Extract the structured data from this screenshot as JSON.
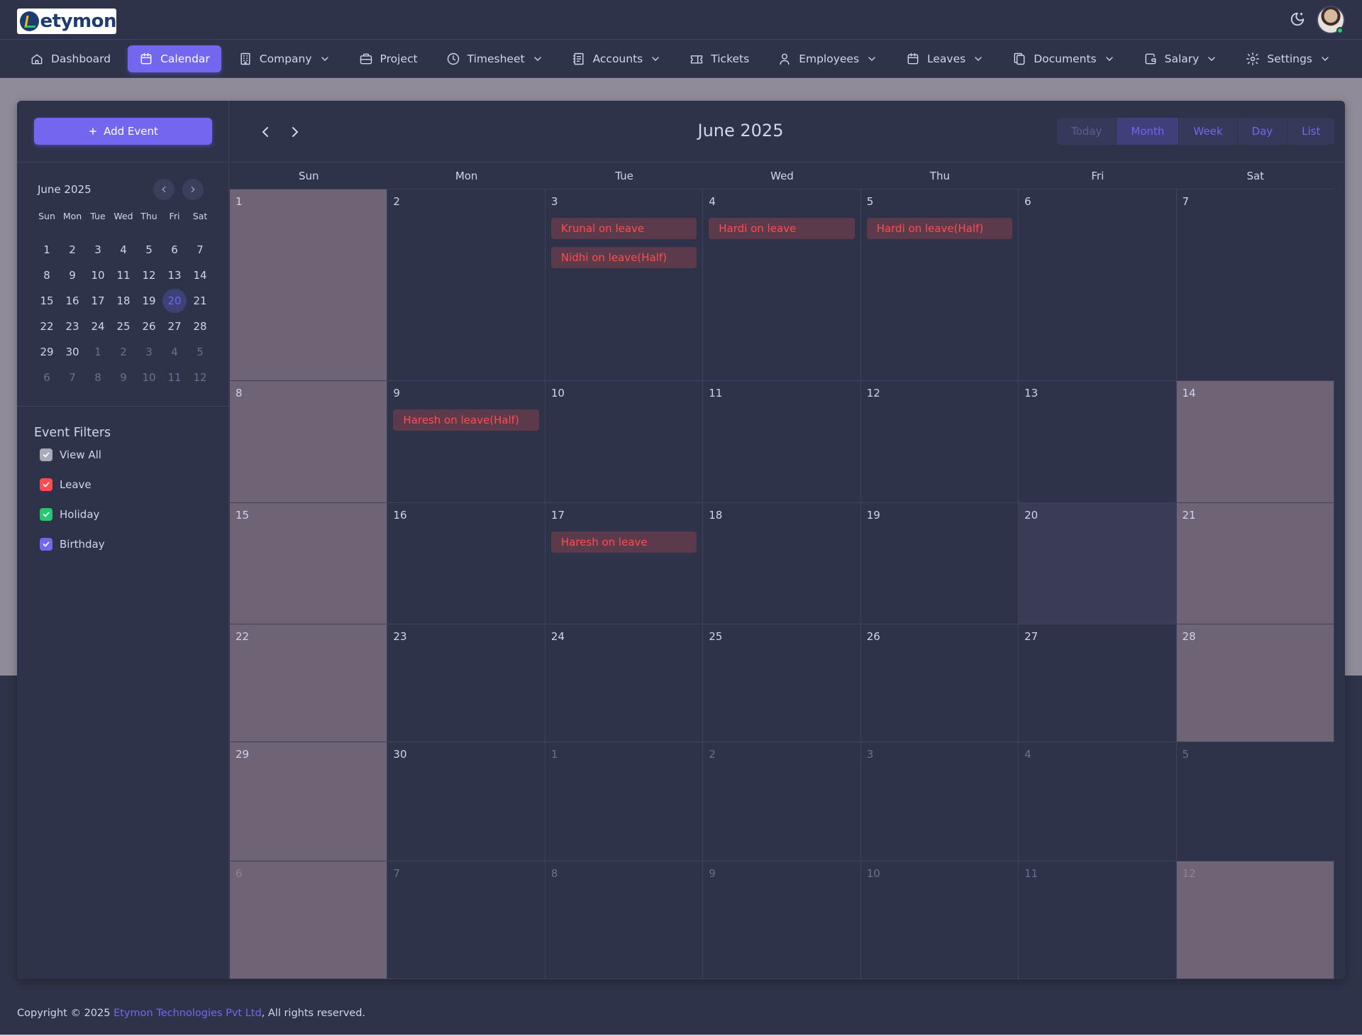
{
  "app": {
    "logo_text": "etymon"
  },
  "nav": {
    "items": [
      {
        "label": "Dashboard",
        "icon": "home-icon",
        "dropdown": false,
        "active": false
      },
      {
        "label": "Calendar",
        "icon": "calendar-icon",
        "dropdown": false,
        "active": true
      },
      {
        "label": "Company",
        "icon": "building-icon",
        "dropdown": true,
        "active": false
      },
      {
        "label": "Project",
        "icon": "briefcase-icon",
        "dropdown": false,
        "active": false
      },
      {
        "label": "Timesheet",
        "icon": "clock-icon",
        "dropdown": true,
        "active": false
      },
      {
        "label": "Accounts",
        "icon": "receipt-icon",
        "dropdown": true,
        "active": false
      },
      {
        "label": "Tickets",
        "icon": "ticket-icon",
        "dropdown": false,
        "active": false
      },
      {
        "label": "Employees",
        "icon": "user-icon",
        "dropdown": true,
        "active": false
      },
      {
        "label": "Leaves",
        "icon": "calendar-icon",
        "dropdown": true,
        "active": false
      },
      {
        "label": "Documents",
        "icon": "files-icon",
        "dropdown": true,
        "active": false
      },
      {
        "label": "Salary",
        "icon": "wallet-icon",
        "dropdown": true,
        "active": false
      },
      {
        "label": "Settings",
        "icon": "gear-icon",
        "dropdown": true,
        "active": false
      }
    ]
  },
  "sidebar": {
    "add_event_label": "Add Event",
    "mini_calendar": {
      "title": "June 2025",
      "weekdays": [
        "Sun",
        "Mon",
        "Tue",
        "Wed",
        "Thu",
        "Fri",
        "Sat"
      ],
      "weeks": [
        [
          "1",
          "2",
          "3",
          "4",
          "5",
          "6",
          "7"
        ],
        [
          "8",
          "9",
          "10",
          "11",
          "12",
          "13",
          "14"
        ],
        [
          "15",
          "16",
          "17",
          "18",
          "19",
          "20",
          "21"
        ],
        [
          "22",
          "23",
          "24",
          "25",
          "26",
          "27",
          "28"
        ],
        [
          "29",
          "30",
          "1",
          "2",
          "3",
          "4",
          "5"
        ],
        [
          "6",
          "7",
          "8",
          "9",
          "10",
          "11",
          "12"
        ]
      ],
      "today": "20"
    },
    "filters_title": "Event Filters",
    "filters": [
      {
        "label": "View All",
        "color": "#a8aab7",
        "checked": true
      },
      {
        "label": "Leave",
        "color": "#ff4c51",
        "checked": true
      },
      {
        "label": "Holiday",
        "color": "#28c76f",
        "checked": true
      },
      {
        "label": "Birthday",
        "color": "#7367f0",
        "checked": true
      }
    ]
  },
  "calendar": {
    "title": "June 2025",
    "views": [
      "Today",
      "Month",
      "Week",
      "Day",
      "List"
    ],
    "active_view": "Month",
    "weekdays": [
      "Sun",
      "Mon",
      "Tue",
      "Wed",
      "Thu",
      "Fri",
      "Sat"
    ],
    "weeks": [
      {
        "days": [
          {
            "n": "1"
          },
          {
            "n": "2"
          },
          {
            "n": "3",
            "events": [
              "Krunal on leave",
              "Nidhi on leave(Half)"
            ]
          },
          {
            "n": "4",
            "events": [
              "Hardi on leave"
            ]
          },
          {
            "n": "5",
            "events": [
              "Hardi on leave(Half)"
            ]
          },
          {
            "n": "6"
          },
          {
            "n": "7"
          }
        ]
      },
      {
        "days": [
          {
            "n": "8"
          },
          {
            "n": "9",
            "events": [
              "Haresh on leave(Half)"
            ]
          },
          {
            "n": "10"
          },
          {
            "n": "11"
          },
          {
            "n": "12"
          },
          {
            "n": "13"
          },
          {
            "n": "14"
          }
        ]
      },
      {
        "days": [
          {
            "n": "15"
          },
          {
            "n": "16"
          },
          {
            "n": "17",
            "events": [
              "Haresh on leave"
            ]
          },
          {
            "n": "18"
          },
          {
            "n": "19"
          },
          {
            "n": "20",
            "today": true
          },
          {
            "n": "21"
          }
        ]
      },
      {
        "days": [
          {
            "n": "22"
          },
          {
            "n": "23"
          },
          {
            "n": "24"
          },
          {
            "n": "25"
          },
          {
            "n": "26"
          },
          {
            "n": "27"
          },
          {
            "n": "28"
          }
        ]
      },
      {
        "days": [
          {
            "n": "29"
          },
          {
            "n": "30"
          },
          {
            "n": "1",
            "other": true
          },
          {
            "n": "2",
            "other": true
          },
          {
            "n": "3",
            "other": true
          },
          {
            "n": "4",
            "other": true
          },
          {
            "n": "5",
            "other": true
          }
        ]
      },
      {
        "days": [
          {
            "n": "6",
            "other": true
          },
          {
            "n": "7",
            "other": true
          },
          {
            "n": "8",
            "other": true
          },
          {
            "n": "9",
            "other": true
          },
          {
            "n": "10",
            "other": true
          },
          {
            "n": "11",
            "other": true
          },
          {
            "n": "12",
            "other": true
          }
        ]
      }
    ]
  },
  "footer": {
    "prefix": "Copyright © 2025 ",
    "company": "Etymon Technologies Pvt Ltd",
    "suffix": ", All rights reserved."
  },
  "colors": {
    "accent": "#7367f0",
    "leave": "#ff4c51",
    "online": "#28c76f"
  }
}
